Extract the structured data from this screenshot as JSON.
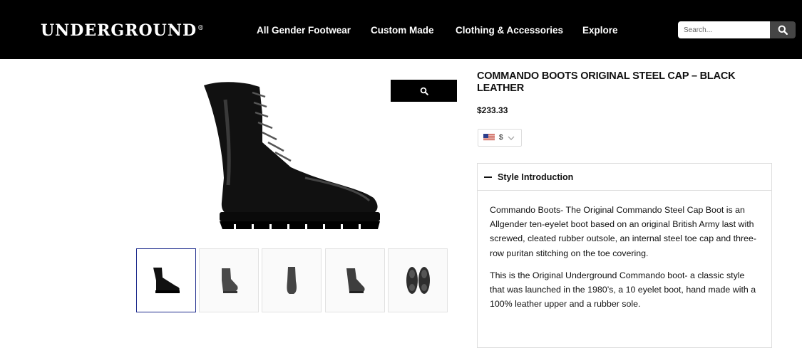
{
  "header": {
    "logo": "UNDERGROUND",
    "logo_mark": "®",
    "nav": [
      "All Gender Footwear",
      "Custom Made",
      "Clothing & Accessories",
      "Explore"
    ],
    "search_placeholder": "Search..."
  },
  "product": {
    "title": "COMMANDO BOOTS ORIGINAL STEEL CAP – BLACK LEATHER",
    "price": "$233.33",
    "currency": {
      "symbol": "$",
      "flag": "us-flag-icon"
    },
    "thumbnails": [
      "boot-side",
      "boot-front-angle",
      "boot-front",
      "boot-angle",
      "boot-soles"
    ],
    "selected_thumbnail": 0
  },
  "accordion": {
    "title": "Style Introduction",
    "expanded": true,
    "paragraphs": [
      "Commando Boots- The Original Commando Steel Cap Boot is an Allgender ten-eyelet boot based on an original British Army last with screwed, cleated rubber outsole, an internal steel toe cap and three-row puritan stitching on the toe covering.",
      "This is the Original Underground Commando boot- a classic style that was launched in the 1980’s, a 10 eyelet boot, hand made with a 100% leather upper and a rubber sole."
    ]
  },
  "colors": {
    "header_bg": "#000000",
    "selected_thumb_border": "#1c2a8c"
  }
}
